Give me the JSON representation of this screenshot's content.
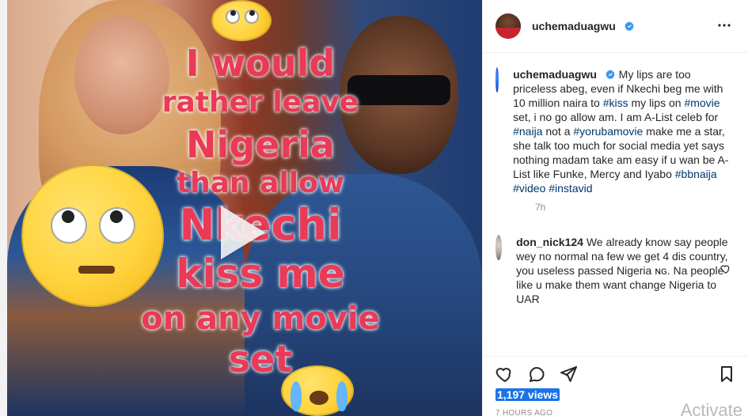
{
  "media": {
    "overlay_lines": [
      "I would",
      "rather leave",
      "Nigeria",
      "than allow",
      "Nkechi",
      "kiss me",
      "on any movie",
      "set"
    ]
  },
  "header": {
    "username": "uchemaduagwu",
    "more_label": "…"
  },
  "caption": {
    "username": "uchemaduagwu",
    "text_parts": [
      {
        "t": "My lips are too priceless abeg, even if Nkechi beg me with 10 million naira to "
      },
      {
        "tag": "#kiss"
      },
      {
        "t": " my lips on "
      },
      {
        "tag": "#movie"
      },
      {
        "t": " set, i no go allow am. I am A-List celeb for "
      },
      {
        "tag": "#naija"
      },
      {
        "t": " not a "
      },
      {
        "tag": "#yorubamovie"
      },
      {
        "t": " make me a star, she talk too much for social media yet says nothing madam take am easy if u wan be A-List like Funke, Mercy and Iyabo "
      },
      {
        "tag": "#bbnaija"
      },
      {
        "t": " "
      },
      {
        "tag": "#video"
      },
      {
        "t": " "
      },
      {
        "tag": "#instavid"
      }
    ],
    "timestamp": "7h"
  },
  "comment": {
    "username": "don_nick124",
    "text": "We already know say people wey no normal na few we get 4 dis country, you useless passed Nigeria ɴɢ. Na people like u make them want change Nigeria to UAR"
  },
  "footer": {
    "views": "1,197 views",
    "ago": "7 HOURS AGO",
    "watermark": "Activate"
  },
  "colors": {
    "text": "#262626",
    "muted": "#8e8e8e",
    "hashtag": "#00376b",
    "verified": "#3897f0",
    "overlay_pink": "#e93a57",
    "views_highlight": "#1a73e8"
  },
  "icons": {
    "verified": "verified-badge-icon",
    "more": "more-horizontal-icon",
    "heart": "heart-icon",
    "comment": "comment-icon",
    "share": "share-icon",
    "save": "bookmark-icon",
    "play": "play-icon"
  }
}
